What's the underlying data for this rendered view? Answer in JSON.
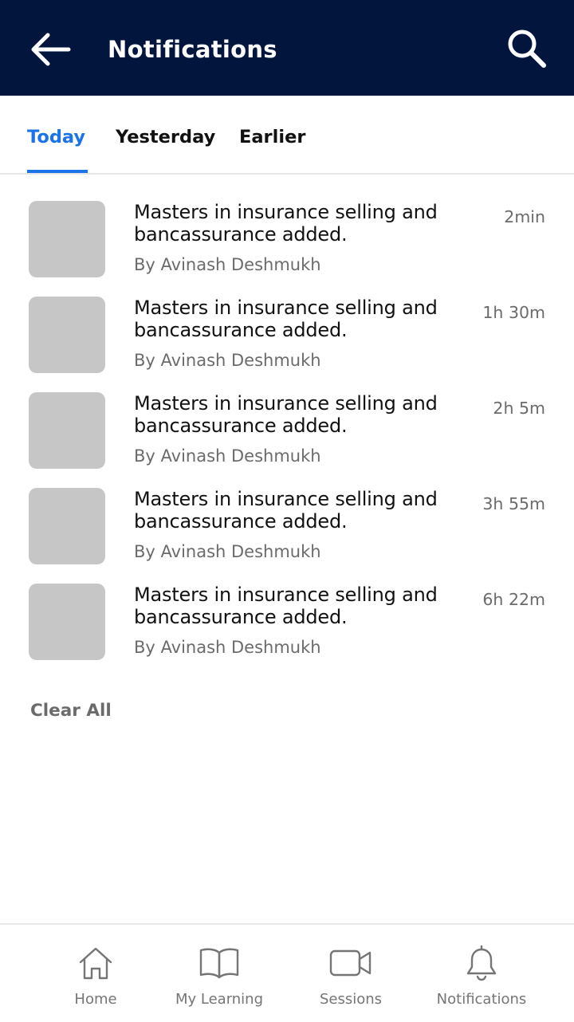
{
  "header": {
    "title": "Notifications",
    "back_icon": "arrow-left-icon",
    "search_icon": "search-icon",
    "background": "#02163d"
  },
  "tabs": [
    {
      "label": "Today",
      "active": true
    },
    {
      "label": "Yesterday",
      "active": false
    },
    {
      "label": "Earlier",
      "active": false
    }
  ],
  "accent_color": "#1a73e8",
  "notifications": [
    {
      "title": "Masters in insurance selling and bancassurance added.",
      "author": "By Avinash Deshmukh",
      "time": "2min"
    },
    {
      "title": "Masters in insurance selling and bancassurance added.",
      "author": "By Avinash Deshmukh",
      "time": "1h 30m"
    },
    {
      "title": "Masters in insurance selling and bancassurance added.",
      "author": "By Avinash Deshmukh",
      "time": "2h 5m"
    },
    {
      "title": "Masters in insurance selling and bancassurance added.",
      "author": "By Avinash Deshmukh",
      "time": "3h 55m"
    },
    {
      "title": "Masters in insurance selling and bancassurance added.",
      "author": "By Avinash Deshmukh",
      "time": "6h 22m"
    }
  ],
  "clear_all_label": "Clear All",
  "bottom_nav": [
    {
      "label": "Home",
      "icon": "home-icon"
    },
    {
      "label": "My Learning",
      "icon": "book-icon"
    },
    {
      "label": "Sessions",
      "icon": "video-camera-icon"
    },
    {
      "label": "Notifications",
      "icon": "bell-icon"
    }
  ]
}
